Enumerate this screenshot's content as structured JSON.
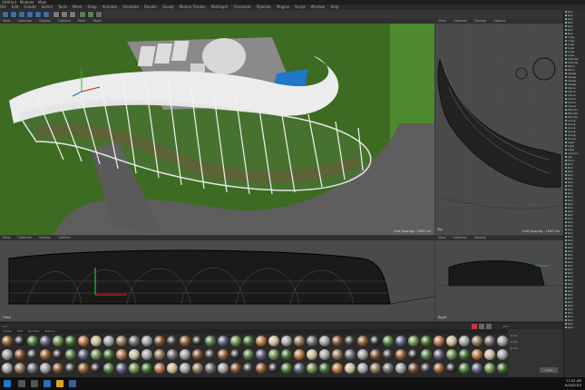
{
  "window": {
    "title": "Untitled - Modeler - Main"
  },
  "menu": [
    "File",
    "Edit",
    "Create",
    "Select",
    "Tools",
    "Mesh",
    "Snap",
    "Animate",
    "Simulate",
    "Render",
    "Sculpt",
    "Motion Tracker",
    "MoGraph",
    "Character",
    "Pipeline",
    "Plugins",
    "Script",
    "Window",
    "Help"
  ],
  "viewports": {
    "perspective": {
      "menu": [
        "View",
        "Cameras",
        "Display",
        "Options",
        "Filter",
        "Panel"
      ],
      "footer": "Grid Spacing : 1000 cm"
    },
    "top": {
      "menu": [
        "View",
        "Cameras",
        "Display",
        "Options",
        "Filter",
        "Panel"
      ],
      "label": "Top",
      "footer": "Grid Spacing : 1000 cm"
    },
    "front": {
      "menu": [
        "View",
        "Cameras",
        "Display",
        "Options",
        "Filter",
        "Panel"
      ],
      "label": "Front"
    },
    "right": {
      "menu": [
        "View",
        "Cameras",
        "Display",
        "Options",
        "Filter",
        "Panel"
      ],
      "label": "Right"
    }
  },
  "objects": [
    "Null",
    "Null",
    "Null",
    "Null",
    "Null",
    "Null",
    "Null",
    "Cube",
    "Cube",
    "Cube",
    "Cube",
    "Cube",
    "Cube",
    "Cylinder",
    "Cylinder",
    "Plane",
    "Plane",
    "Sweep",
    "Sweep",
    "Sweep",
    "Sweep",
    "Spline",
    "Spline",
    "Spline",
    "Cloner",
    "Cloner",
    "Cloner",
    "Extrude",
    "Extrude",
    "Extrude",
    "Group",
    "Group",
    "Group",
    "Group",
    "Group",
    "Group",
    "Light",
    "Light",
    "Light",
    "Camera",
    "Sky",
    "Floor",
    "Null",
    "Null",
    "Null",
    "Null",
    "Null",
    "Null",
    "Null",
    "Null",
    "Null",
    "Null",
    "Null",
    "Null",
    "Null",
    "Null",
    "Null",
    "Null",
    "Null",
    "Null",
    "Null",
    "Null",
    "Null",
    "Null",
    "Null",
    "Null",
    "Null",
    "Null",
    "Null",
    "Null",
    "Null",
    "Null",
    "Null",
    "Null",
    "Null",
    "Null",
    "Null",
    "Null",
    "Null",
    "Null",
    "Null",
    "Null",
    "Null",
    "Null",
    "Null",
    "Null",
    "Null",
    "Null"
  ],
  "timeline": {
    "current_frame": "0 F",
    "end_frame": "90 F"
  },
  "coords": {
    "x": "0 cm",
    "y": "0 cm",
    "z": "0 cm",
    "apply": "Apply"
  },
  "material_bar": {
    "menu": [
      "Create",
      "Edit",
      "Function",
      "Texture"
    ]
  },
  "clock": {
    "time": "11:42 AM",
    "date": "6/18/2019"
  },
  "colors": {
    "grass": "#3d6b22",
    "road": "#5a5a5a",
    "roof": "#e6e6e6",
    "accent": "#1f77c8"
  }
}
